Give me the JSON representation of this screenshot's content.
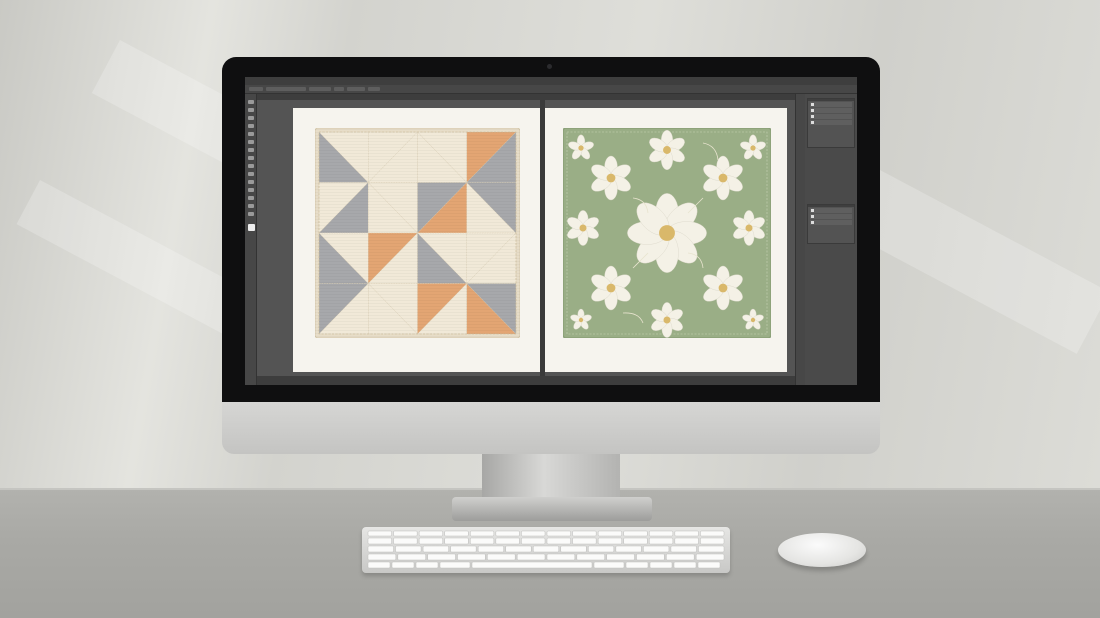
{
  "scene": {
    "description_colors": {
      "wall": "#d9d9d5",
      "desk": "#a9a9a5",
      "bezel": "#0f0f10",
      "app_bg": "#535353"
    }
  },
  "app": {
    "menu": [
      "",
      "",
      "",
      "",
      "",
      "",
      "",
      "",
      "",
      "",
      ""
    ],
    "status": {
      "zoom": "",
      "doc": ""
    },
    "panels": {
      "layers_title": "",
      "properties_title": ""
    }
  },
  "documents": {
    "left": {
      "pattern": "quilt-geometric",
      "colors": {
        "cream": "#f1e9d8",
        "gray": "#a7a8ab",
        "peach": "#e3a573",
        "border": "#e7ddc8"
      }
    },
    "right": {
      "pattern": "floral-embroidery",
      "colors": {
        "bg": "#9aae86",
        "petal": "#f4f1e6",
        "center": "#d9b86a",
        "border": "#8a9f77"
      }
    }
  },
  "icons": {
    "camera": "camera-icon",
    "tools": "toolbar-icons"
  }
}
